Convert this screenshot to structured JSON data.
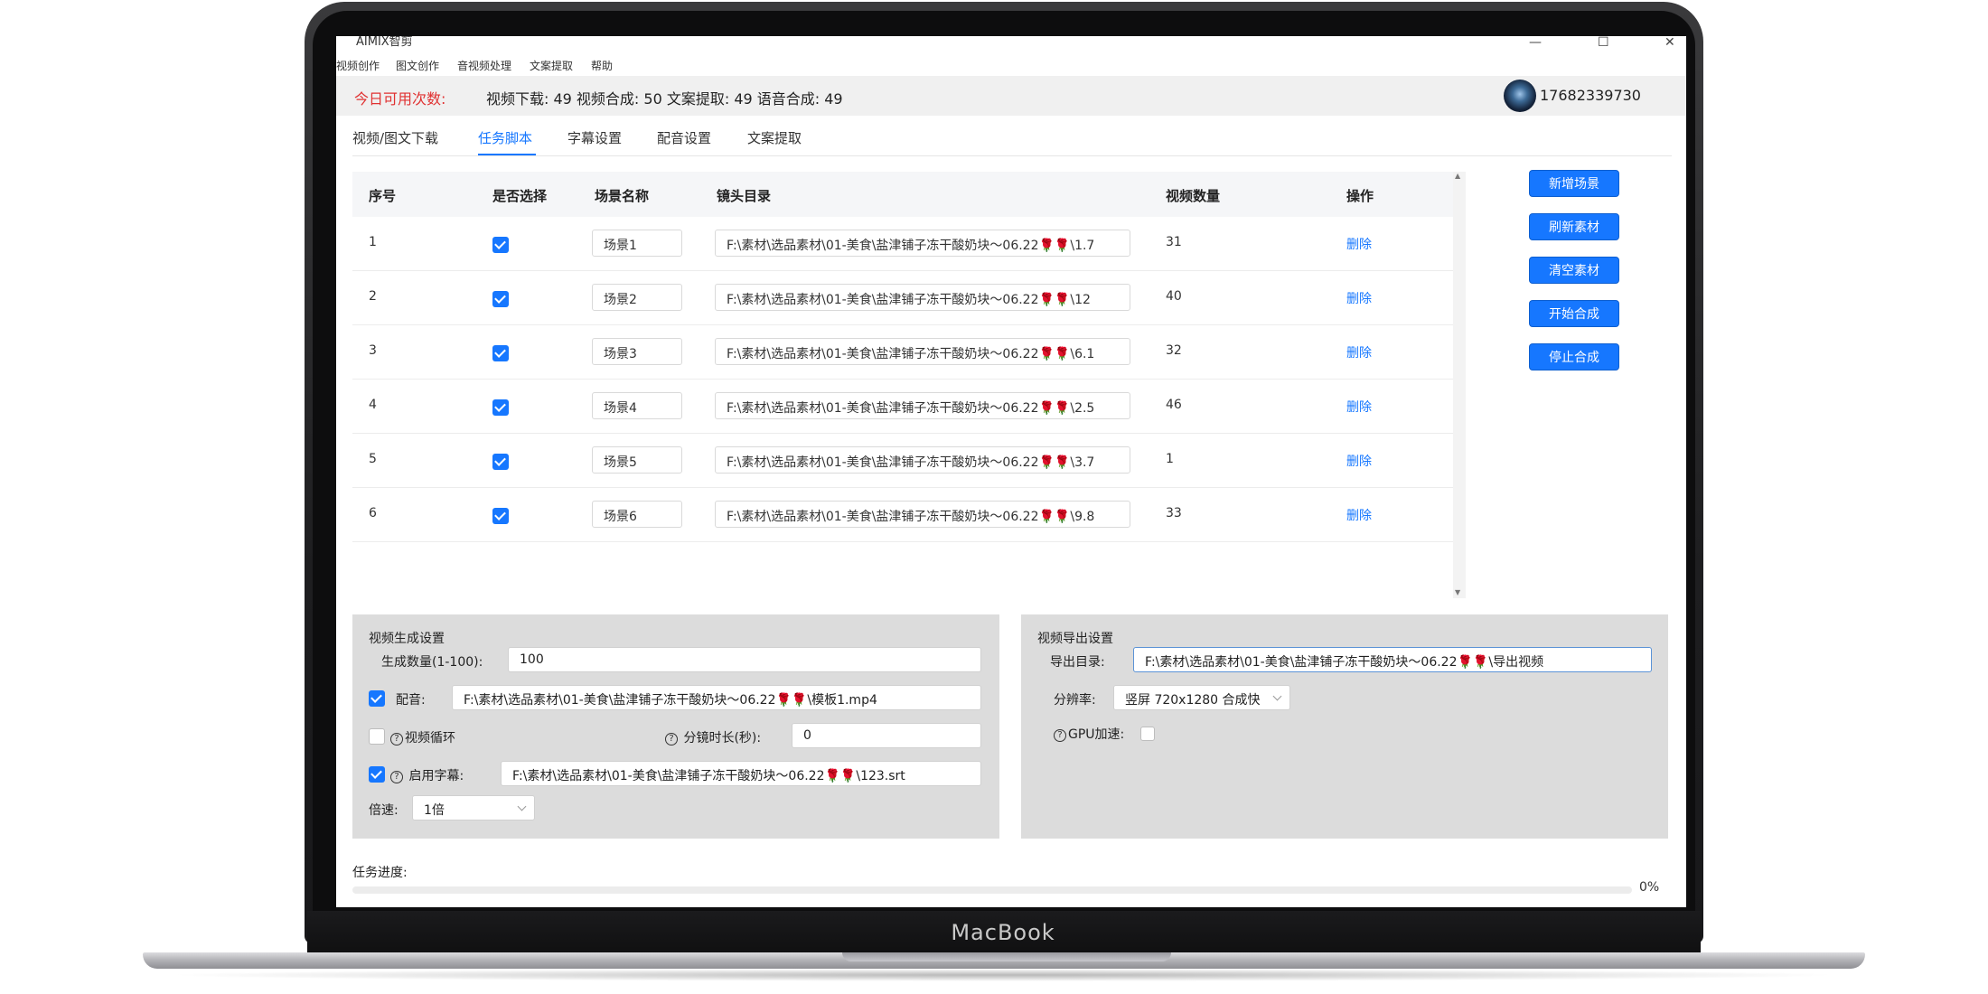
{
  "device": {
    "brand": "MacBook"
  },
  "window": {
    "title": "AIMIX智剪",
    "controls": {
      "minimize": "—",
      "maximize": "☐",
      "close": "✕"
    }
  },
  "menu": {
    "items": [
      "视频创作",
      "图文创作",
      "音视频处理",
      "文案提取",
      "帮助"
    ]
  },
  "quota": {
    "label": "今日可用次数:",
    "stats": "视频下载: 49   视频合成: 50   文案提取: 49   语音合成: 49"
  },
  "user": {
    "phone": "17682339730"
  },
  "tabs": [
    {
      "label": "视频/图文下载"
    },
    {
      "label": "任务脚本",
      "active": true
    },
    {
      "label": "字幕设置"
    },
    {
      "label": "配音设置"
    },
    {
      "label": "文案提取"
    }
  ],
  "table": {
    "headers": [
      "序号",
      "是否选择",
      "场景名称",
      "镜头目录",
      "视频数量",
      "操作"
    ],
    "rows": [
      {
        "index": "1",
        "selected": true,
        "scene": "场景1",
        "path": "F:\\素材\\选品素材\\01-美食\\盐津铺子冻干酸奶块～06.22🌹🌹\\1.7",
        "count": "31",
        "action": "删除"
      },
      {
        "index": "2",
        "selected": true,
        "scene": "场景2",
        "path": "F:\\素材\\选品素材\\01-美食\\盐津铺子冻干酸奶块～06.22🌹🌹\\12",
        "count": "40",
        "action": "删除"
      },
      {
        "index": "3",
        "selected": true,
        "scene": "场景3",
        "path": "F:\\素材\\选品素材\\01-美食\\盐津铺子冻干酸奶块～06.22🌹🌹\\6.1",
        "count": "32",
        "action": "删除"
      },
      {
        "index": "4",
        "selected": true,
        "scene": "场景4",
        "path": "F:\\素材\\选品素材\\01-美食\\盐津铺子冻干酸奶块～06.22🌹🌹\\2.5",
        "count": "46",
        "action": "删除"
      },
      {
        "index": "5",
        "selected": true,
        "scene": "场景5",
        "path": "F:\\素材\\选品素材\\01-美食\\盐津铺子冻干酸奶块～06.22🌹🌹\\3.7",
        "count": "1",
        "action": "删除"
      },
      {
        "index": "6",
        "selected": true,
        "scene": "场景6",
        "path": "F:\\素材\\选品素材\\01-美食\\盐津铺子冻干酸奶块～06.22🌹🌹\\9.8",
        "count": "33",
        "action": "删除"
      }
    ]
  },
  "side_buttons": [
    "新增场景",
    "刷新素材",
    "清空素材",
    "开始合成",
    "停止合成"
  ],
  "gen_settings": {
    "title": "视频生成设置",
    "count_label": "生成数量(1-100):",
    "count_value": "100",
    "dub_enabled": true,
    "dub_label": "配音:",
    "dub_value": "F:\\素材\\选品素材\\01-美食\\盐津铺子冻干酸奶块～06.22🌹🌹\\模板1.mp4",
    "loop_enabled": false,
    "loop_label": "视频循环",
    "shot_label": "分镜时长(秒):",
    "shot_value": "0",
    "subtitle_enabled": true,
    "subtitle_label": "启用字幕:",
    "subtitle_value": "F:\\素材\\选品素材\\01-美食\\盐津铺子冻干酸奶块～06.22🌹🌹\\123.srt",
    "speed_label": "倍速:",
    "speed_value": "1倍"
  },
  "export_settings": {
    "title": "视频导出设置",
    "dir_label": "导出目录:",
    "dir_value": "F:\\素材\\选品素材\\01-美食\\盐津铺子冻干酸奶块～06.22🌹🌹\\导出视频",
    "res_label": "分辨率:",
    "res_value": "竖屏 720x1280 合成快",
    "gpu_label": "GPU加速:",
    "gpu_enabled": false
  },
  "progress": {
    "label": "任务进度:",
    "percent_text": "0%",
    "percent": 0
  },
  "colors": {
    "accent": "#1677ff",
    "quota_label": "#e03131",
    "panel_bg": "#dcdcdc"
  }
}
